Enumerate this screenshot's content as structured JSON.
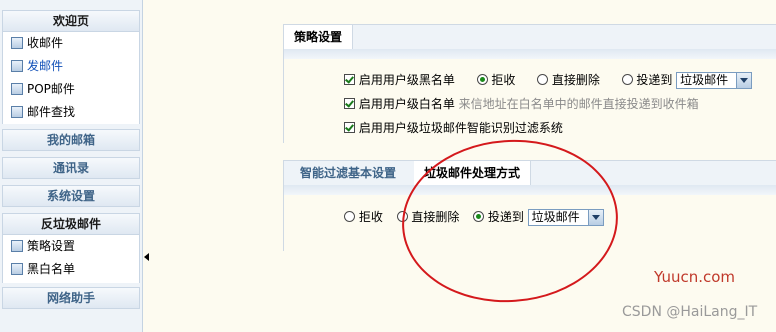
{
  "sidebar": {
    "welcome": {
      "title": "欢迎页",
      "items": [
        {
          "label": "收邮件",
          "icon": "inbox-icon"
        },
        {
          "label": "发邮件",
          "icon": "compose-icon"
        },
        {
          "label": "POP邮件",
          "icon": "pop-mail-icon"
        },
        {
          "label": "邮件查找",
          "icon": "mail-search-icon"
        }
      ]
    },
    "sections": [
      "我的邮箱",
      "通讯录",
      "系统设置"
    ],
    "antispam": {
      "title": "反垃圾邮件",
      "items": [
        {
          "label": "策略设置",
          "icon": "policy-settings-icon"
        },
        {
          "label": "黑白名单",
          "icon": "blacklist-icon"
        }
      ]
    },
    "assistant": "网络助手"
  },
  "policy_panel": {
    "tab": "策略设置",
    "blacklist": {
      "label": "启用用户级黑名单",
      "checked": true,
      "options": [
        "拒收",
        "直接删除",
        "投递到"
      ],
      "selected_option": "拒收",
      "folder": "垃圾邮件"
    },
    "whitelist": {
      "label": "启用用户级白名单",
      "hint": "来信地址在白名单中的邮件直接投递到收件箱",
      "checked": true
    },
    "smart_filter": {
      "label": "启用用户级垃圾邮件智能识别过滤系统",
      "checked": true
    }
  },
  "filter_panel": {
    "tabs": [
      "智能过滤基本设置",
      "垃圾邮件处理方式"
    ],
    "active_tab": "垃圾邮件处理方式",
    "options": [
      "拒收",
      "直接删除",
      "投递到"
    ],
    "selected_option": "投递到",
    "folder": "垃圾邮件"
  },
  "watermarks": {
    "site": "Yuucn.com",
    "author": "CSDN @HaiLang_IT"
  },
  "colors": {
    "annotation_ellipse": "#d4191c",
    "active_link": "#1150b8",
    "check_mark": "#1a7a1a"
  }
}
